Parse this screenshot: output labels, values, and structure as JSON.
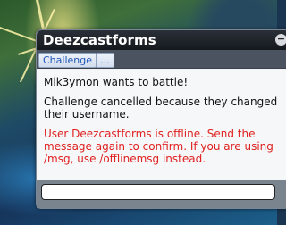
{
  "window": {
    "title": "Deezcastforms",
    "minimize_glyph": "−"
  },
  "toolbar": {
    "challenge_label": "Challenge",
    "more_label": "..."
  },
  "log": {
    "messages": [
      "Mik3ymon wants to battle!",
      "Challenge cancelled because they changed their username.",
      "User Deezcastforms is offline. Send the message again to confirm. If you are using /msg, use /offlinemsg instead."
    ],
    "error_color": "#e02020"
  },
  "chat_input": {
    "value": ""
  }
}
